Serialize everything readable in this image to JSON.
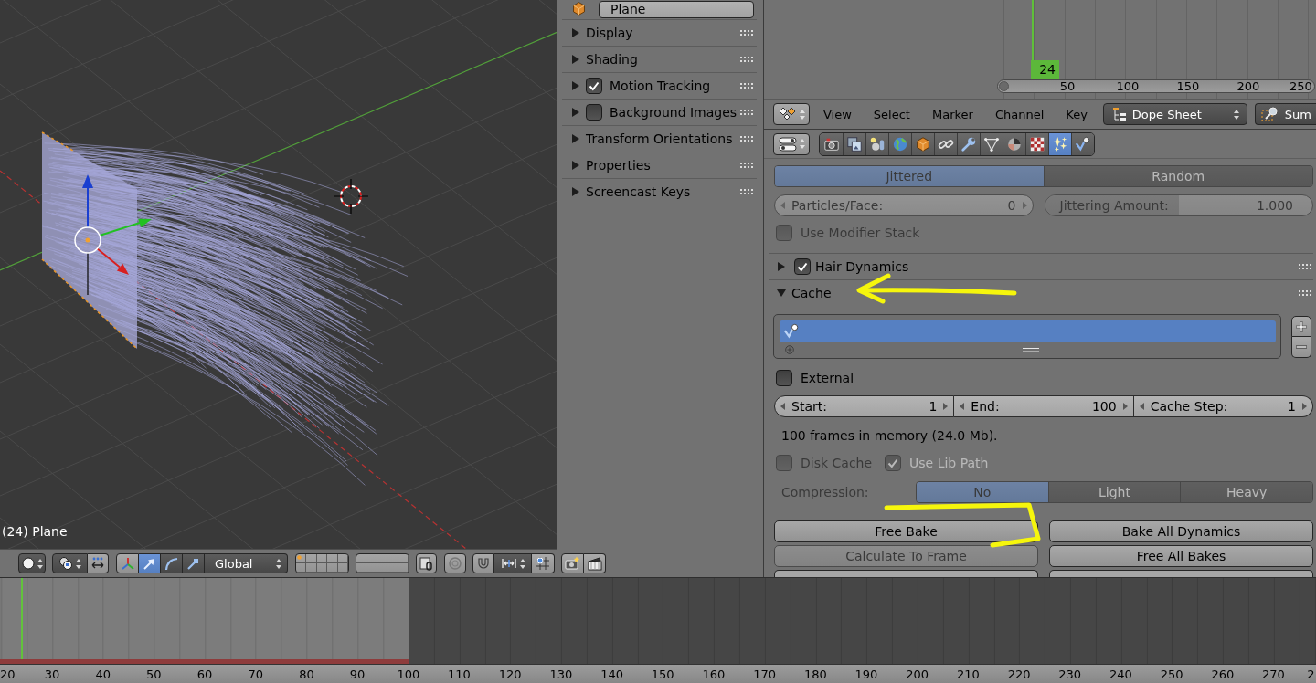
{
  "viewport": {
    "object_label": "(24) Plane",
    "header": {
      "manipulators": [
        {
          "kind": "translate",
          "selected": true
        },
        {
          "kind": "rotate",
          "selected": false
        },
        {
          "kind": "scale",
          "selected": false
        }
      ],
      "orientation": "Global",
      "layers": [
        {
          "occupied": true
        },
        {
          "occupied": false
        },
        {
          "occupied": false
        },
        {
          "occupied": false
        },
        {
          "occupied": false
        },
        {
          "occupied": false
        },
        {
          "occupied": false
        },
        {
          "occupied": false
        },
        {
          "occupied": false
        },
        {
          "occupied": false
        },
        {
          "occupied": false
        },
        {
          "occupied": false
        },
        {
          "occupied": false
        },
        {
          "occupied": false
        },
        {
          "occupied": false
        },
        {
          "occupied": false
        },
        {
          "occupied": false
        },
        {
          "occupied": false
        },
        {
          "occupied": false
        },
        {
          "occupied": false
        }
      ]
    }
  },
  "n_panel": {
    "object_name": "Plane",
    "panels": [
      {
        "kind": "plain",
        "label": "Display",
        "expanded": false
      },
      {
        "kind": "plain",
        "label": "Shading",
        "expanded": false
      },
      {
        "kind": "checkbox",
        "label": "Motion Tracking",
        "checked": true,
        "expanded": false
      },
      {
        "kind": "checkbox",
        "label": "Background Images",
        "checked": false,
        "expanded": false
      },
      {
        "kind": "plain",
        "label": "Transform Orientations",
        "expanded": false
      },
      {
        "kind": "plain",
        "label": "Properties",
        "expanded": false
      },
      {
        "kind": "plain",
        "label": "Screencast Keys",
        "expanded": false
      }
    ]
  },
  "dope_sheet": {
    "current_frame": "24",
    "ruler": [
      "50",
      "100",
      "150",
      "200",
      "250"
    ],
    "header": {
      "menus": [
        "View",
        "Select",
        "Marker",
        "Channel",
        "Key"
      ],
      "mode": "Dope Sheet",
      "summary": "Sum"
    }
  },
  "properties": {
    "tabs": [
      {
        "kind": "render",
        "selected": false
      },
      {
        "kind": "render_layers",
        "selected": false
      },
      {
        "kind": "scene",
        "selected": false
      },
      {
        "kind": "world",
        "selected": false
      },
      {
        "kind": "object",
        "selected": false
      },
      {
        "kind": "constraints",
        "selected": false
      },
      {
        "kind": "modifiers",
        "selected": false
      },
      {
        "kind": "data",
        "selected": false
      },
      {
        "kind": "material",
        "selected": false
      },
      {
        "kind": "texture",
        "selected": false
      },
      {
        "kind": "particles",
        "selected": true
      },
      {
        "kind": "physics",
        "selected": false
      }
    ],
    "distribution": {
      "disabled": true,
      "options": [
        {
          "label": "Jittered",
          "selected": true
        },
        {
          "label": "Random",
          "selected": false
        }
      ]
    },
    "particles_per_face": {
      "label": "Particles/Face:",
      "value": "0",
      "disabled": true
    },
    "jittering_amount": {
      "label": "Jittering Amount:",
      "value": "1.000",
      "level": 0.5,
      "disabled": true
    },
    "use_modifier_stack": {
      "label": "Use Modifier Stack",
      "checked": false,
      "disabled": true
    },
    "hair_dynamics": {
      "label": "Hair Dynamics",
      "checked": true,
      "expanded": false
    },
    "cache": {
      "label": "Cache",
      "expanded": true,
      "list": [
        {
          "selected": true
        }
      ],
      "external": {
        "label": "External",
        "checked": false,
        "disabled": false
      },
      "range": [
        {
          "label": "Start:",
          "value": "1"
        },
        {
          "label": "End:",
          "value": "100"
        },
        {
          "label": "Cache Step:",
          "value": "1"
        }
      ],
      "info": "100 frames in memory (24.0 Mb).",
      "disk_cache": {
        "label": "Disk Cache",
        "checked": false,
        "disabled": true
      },
      "use_lib_path": {
        "label": "Use Lib Path",
        "checked": true,
        "disabled": true
      },
      "compression": {
        "label": "Compression:",
        "disabled": true,
        "options": [
          {
            "label": "No",
            "selected": true
          },
          {
            "label": "Light",
            "selected": false
          },
          {
            "label": "Heavy",
            "selected": false
          }
        ]
      },
      "buttons": [
        {
          "label": "Free Bake",
          "disabled": false
        },
        {
          "label": "Bake All Dynamics",
          "disabled": false
        },
        {
          "label": "Calculate To Frame",
          "disabled": true
        },
        {
          "label": "Free All Bakes",
          "disabled": false
        }
      ]
    }
  },
  "timeline": {
    "ruler": [
      "20",
      "30",
      "40",
      "50",
      "60",
      "70",
      "80",
      "90",
      "100",
      "110",
      "120",
      "130",
      "140",
      "150",
      "160",
      "170",
      "180",
      "190",
      "200",
      "210",
      "220",
      "230",
      "240",
      "250",
      "260",
      "270",
      "2"
    ]
  }
}
